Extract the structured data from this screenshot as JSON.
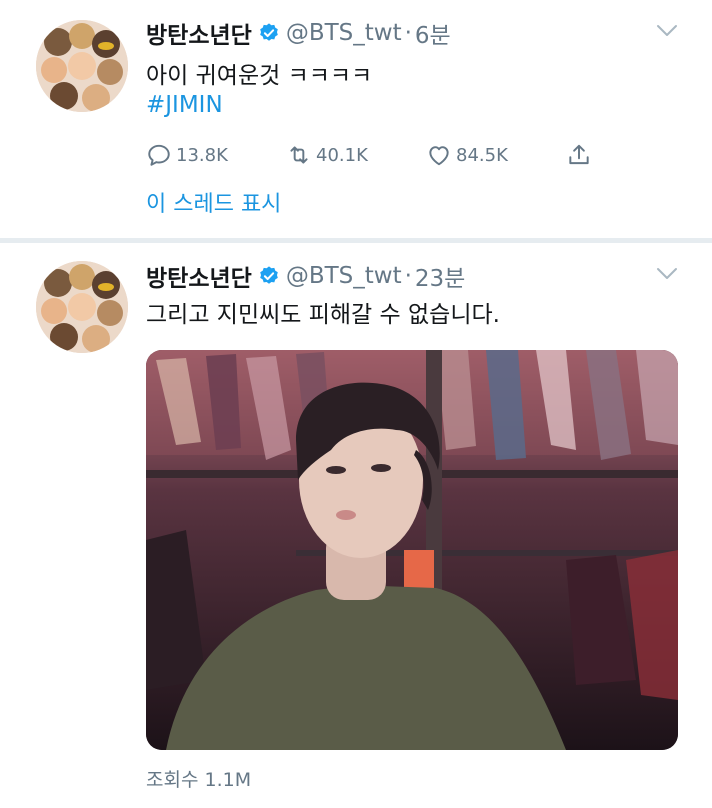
{
  "tweets": [
    {
      "name": "방탄소년단",
      "handle": "@BTS_twt",
      "separator": "·",
      "time": "6분",
      "text": "아이 귀여운것 ㅋㅋㅋㅋ",
      "hashtag": "#JIMIN",
      "replies": "13.8K",
      "retweets": "40.1K",
      "likes": "84.5K",
      "thread_link": "이 스레드 표시"
    },
    {
      "name": "방탄소년단",
      "handle": "@BTS_twt",
      "separator": "·",
      "time": "23분",
      "text": "그리고 지민씨도 피해갈 수 없습니다.",
      "views": "조회수 1.1M"
    }
  ],
  "colors": {
    "link": "#1b95e0",
    "secondary": "#657786",
    "verified": "#1da1f2",
    "divider": "#e6ecf0"
  },
  "icons": [
    "verified-badge-icon",
    "chevron-down-icon",
    "reply-icon",
    "retweet-icon",
    "like-icon",
    "share-icon"
  ]
}
